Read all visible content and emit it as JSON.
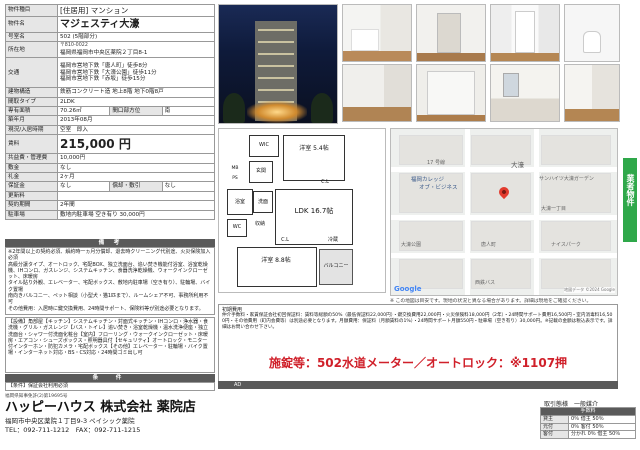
{
  "property": {
    "type_label": "物件種目",
    "type_value": "[住居用] マンション",
    "name_label": "物件名",
    "name_value": "マジェスティ大濠",
    "room_label": "号室名",
    "room_value": "502 (5階部分)",
    "address_label": "所在地",
    "postal": "〒810-0022",
    "address_value": "福岡県福岡市中央区薬院２丁目8-1",
    "transport_label": "交通",
    "transport_lines": [
      "福岡市営地下鉄「唐人町」徒歩8分",
      "福岡市営地下鉄「大濠公園」徒歩11分",
      "福岡市営地下鉄「赤坂」徒歩15分"
    ],
    "structure_label": "建物構造",
    "structure_value": "鉄筋コンクリート造 地上8階 地下0階8戸",
    "layout_label": "間取タイプ",
    "layout_value": "2LDK",
    "area_label": "専有面積",
    "area_value": "70.26㎡",
    "direction_label": "間口部方位",
    "direction_value": "南",
    "built_label": "築年月",
    "built_value": "2013年08月",
    "status_label": "現況/入居時期",
    "status_value": "空室　即入",
    "rent_label": "賃料",
    "rent_value": "215,000 円",
    "common_label": "共益費・管理費",
    "common_value": "10,000円",
    "deposit_label": "敷金",
    "deposit_value": "なし",
    "keymoney_label": "礼金",
    "keymoney_value": "2ヶ月",
    "guarantee_label": "保証金",
    "guarantee_value": "なし",
    "amortize_label": "償却・敷引",
    "amortize_value": "なし",
    "renewal_label": "更新料",
    "renewal_value": "",
    "contract_label": "契約期間",
    "contract_value": "2年間",
    "parking_label": "駐車場",
    "parking_value": "敷地内駐車場 空き有り 30,000円"
  },
  "remarks": {
    "heading": "備　考",
    "lines": [
      "※2年間以上の契約必須、解約時一ヵ月分償却、退去時クリーニング代別途、火災保険加入必須",
      "高級分譲タイプ、オートロック、宅配BOX、独立洗面台、追い焚き機能付浴室、浴室乾燥機、IHコンロ、ガスレンジ、システムキッチン、食器洗浄乾燥機、ウォークインクローゼット、床暖房",
      "タイル貼り外観、エレベーター、宅配ボックス、敷地内駐車場（空き有り）、駐輪場、バイク置場",
      "南向きバルコニー、ペット相談（小型犬・猫1匹まで）、ルームシェア不可、事務所利用不可",
      "その他費用：入居時に鍵交換費用、24時間サポート、保険料等が別途必要となります。"
    ],
    "equipment": "【設備】角部屋【キッチン】システムキッチン・対面式キッチン・IHコンロ・浄水器・食洗機・グリル・ガスレンジ【バス・トイレ】追い焚き・浴室乾燥機・温水洗浄便座・独立洗面台・シャワー付洗面化粧台【室内】フローリング・ウォークインクローゼット・床暖房・エアコン・シューズボックス・照明器具付【セキュリティ】オートロック・モニター付インターホン・防犯カメラ・宅配ボックス【その他】エレベーター・駐輪場・バイク置場・インターネット対応・BS・CS対応・24時間ゴミ出し可"
  },
  "conditions": {
    "heading": "条　件",
    "lines": "【条件】保証会社利用必須"
  },
  "fees": {
    "title": "初期費用",
    "body": "仲介手数料・家賃保証会社初回保証料：賃料等総額の50%（最低保証料22,000円）・鍵交換費用22,000円・火災保険料18,000円（2年）・24時間サポート費用16,500円・室内消毒料16,500円・その他費用（町内会費等）は別途必要となります。月額費用：保証料（月額賃料の1%）・24時間サポート月額550円・駐車場（空き有り）30,000円。※記載の金額は税込表示です。詳細はお問い合わせ下さい。",
    "headline": "施錠等：502水道メーター／オートロック：※1107押"
  },
  "map": {
    "attribution": "地図データ ©2024 Google",
    "note": "※ この地図は目安です。現地の状況と異なる場合があります。詳細は現地をご確認ください。",
    "labels": [
      "大濠",
      "17 号線",
      "福岡カレッジ",
      "オブ・ビジネス",
      "サンハイツ大濠ガーデン",
      "大濠一丁目",
      "大濠公園",
      "唐人町",
      "ナイスパーク",
      "西鉄バス"
    ]
  },
  "floorplan": {
    "rooms": [
      "洋室 5.4帖",
      "LDK 16.7帖",
      "洋室 8.8帖"
    ],
    "small_labels": [
      "WIC",
      "玄関",
      "浴室",
      "洗面",
      "WC",
      "収納",
      "C.L",
      "C.L",
      "冷蔵",
      "バルコニー",
      "MB",
      "PS"
    ]
  },
  "ad_bar": {
    "label": "AD"
  },
  "side_tab": {
    "label": "業者物件"
  },
  "company": {
    "note": "福岡県知事免許(2)第19695号",
    "name": "ハッピーハウス 株式会社 薬院店",
    "address": "福岡市中央区薬院１丁目9-3 ペイシック薬院",
    "phone": "TEL：092-711-1212　FAX：092-711-1215"
  },
  "broker": {
    "title": "取引態様　一般媒介",
    "head": "手数料",
    "rows": [
      {
        "label": "貸主",
        "value": "0％ 借主 50％"
      },
      {
        "label": "元付",
        "value": "0％ 客付 50％"
      },
      {
        "label": "客付",
        "value": "分かれ 0％ 借主 50％"
      }
    ]
  },
  "colors": {
    "accent_red": "#d0202a",
    "tab_green": "#2fa84a",
    "header_gray": "#5a5a5a"
  }
}
